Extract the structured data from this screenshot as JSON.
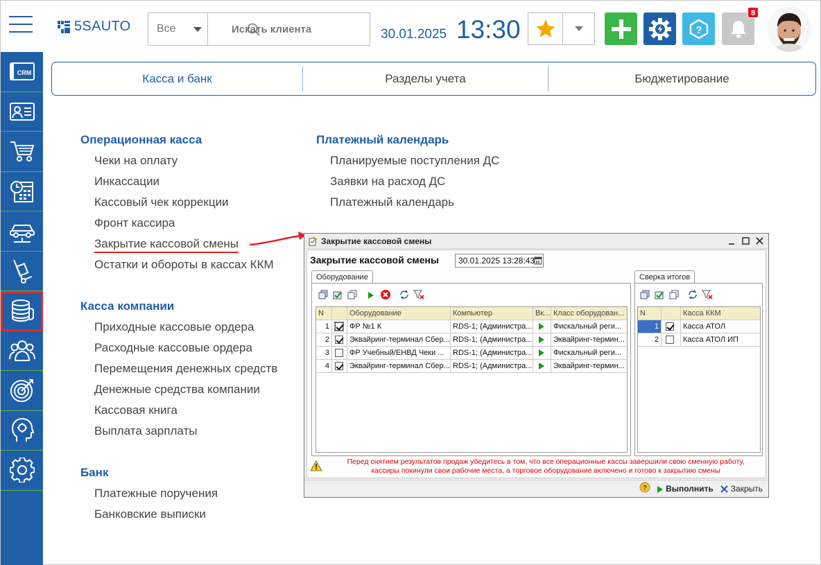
{
  "header": {
    "logo_text": "5SAUTO",
    "search_scope": "Все",
    "search_placeholder": "Искать клиента",
    "date": "30.01.2025",
    "time": "13:30",
    "notifications_count": "8"
  },
  "sidebar": {
    "items": [
      {
        "name": "crm",
        "icon": "crm-icon",
        "label": "CRM"
      },
      {
        "name": "clients",
        "icon": "contact-card-icon"
      },
      {
        "name": "sales",
        "icon": "cart-icon"
      },
      {
        "name": "schedule",
        "icon": "calendar-clock-icon"
      },
      {
        "name": "service",
        "icon": "car-lift-icon"
      },
      {
        "name": "warehouse",
        "icon": "hand-truck-icon"
      },
      {
        "name": "finance",
        "icon": "coins-icon",
        "active": true
      },
      {
        "name": "staff",
        "icon": "people-icon"
      },
      {
        "name": "marketing",
        "icon": "target-icon"
      },
      {
        "name": "analytics",
        "icon": "head-brain-icon"
      },
      {
        "name": "settings",
        "icon": "gear-icon"
      }
    ]
  },
  "tabs": [
    "Касса и банк",
    "Разделы учета",
    "Бюджетирование"
  ],
  "sections": {
    "cash_ops": {
      "title": "Операционная касса",
      "items": [
        "Чеки на оплату",
        "Инкассации",
        "Кассовый чек коррекции",
        "Фронт кассира",
        "Закрытие кассовой смены",
        "Остатки и обороты в кассах ККМ"
      ]
    },
    "company_cash": {
      "title": "Касса компании",
      "items": [
        "Приходные кассовые ордера",
        "Расходные кассовые ордера",
        "Перемещения денежных средств",
        "Денежные средства компании",
        "Кассовая книга",
        "Выплата зарплаты"
      ]
    },
    "bank": {
      "title": "Банк",
      "items": [
        "Платежные поручения",
        "Банковские выписки"
      ]
    },
    "calendar": {
      "title": "Платежный календарь",
      "items": [
        "Планируемые поступления ДС",
        "Заявки на расход ДС",
        "Платежный календарь"
      ]
    }
  },
  "dialog": {
    "window_title": "Закрытие кассовой смены",
    "heading": "Закрытие кассовой смены",
    "datetime": "30.01.2025 13:28:43",
    "equipment_tab": "Оборудование",
    "reconcile_tab": "Сверка итогов",
    "equipment_columns": [
      "N",
      "",
      "Оборудование",
      "Компьютер",
      "Вк...",
      "Класс оборудован..."
    ],
    "equipment_rows": [
      {
        "n": "1",
        "checked": true,
        "equipment": "ФР №1 К",
        "computer": "RDS-1; (Администра...",
        "class": "Фискальный реги..."
      },
      {
        "n": "2",
        "checked": true,
        "equipment": "Эквайринг-терминал Сбер...",
        "computer": "RDS-1; (Администра...",
        "class": "Эквайринг-термин..."
      },
      {
        "n": "3",
        "checked": false,
        "equipment": "ФР Учебный/ЕНВД Чеки ...",
        "computer": "RDS-1; (Администра...",
        "class": "Фискальный реги..."
      },
      {
        "n": "4",
        "checked": true,
        "equipment": "Эквайринг-терминал Сбер...",
        "computer": "RDS-1; (Администра...",
        "class": "Эквайринг-термин..."
      }
    ],
    "kkm_columns": [
      "N",
      "",
      "Касса ККМ"
    ],
    "kkm_rows": [
      {
        "n": "1",
        "checked": true,
        "name": "Касса АТОЛ"
      },
      {
        "n": "2",
        "checked": false,
        "name": "Касса АТОЛ ИП"
      }
    ],
    "warning_line1": "Перед снятием результатов продаж убедитесь в том, что все операционные кассы завершили свою сменную работу,",
    "warning_line2": "кассиры покинули свои рабочие места, а торговое оборудование включено и готово к закрытию смены",
    "run_label": "Выполнить",
    "close_label": "Закрыть"
  },
  "colors": {
    "brand_blue": "#1f5fa8",
    "sidebar_divider": "#5ab04a",
    "active_outline": "#e12b2b",
    "add_tile": "#3cb54a",
    "settings_tile": "#1f5fa8",
    "help_tile": "#3fb8e6",
    "bell_tile": "#c8c8c8",
    "warning_text": "#e00000",
    "grid_header": "#f4eec7"
  }
}
